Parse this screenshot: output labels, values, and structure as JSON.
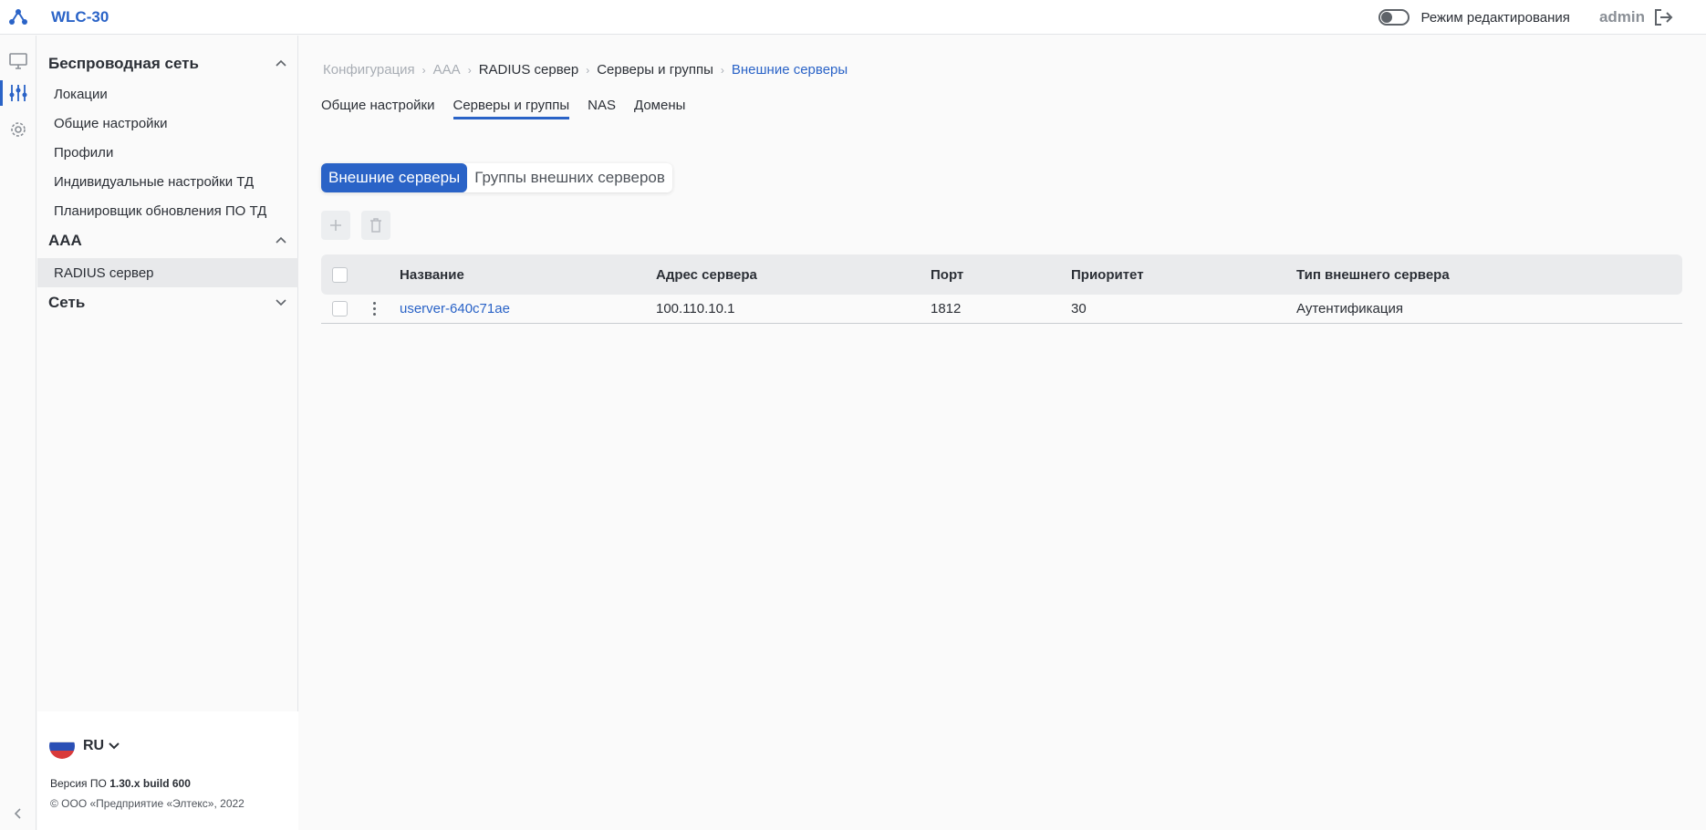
{
  "app": {
    "title": "WLC-30"
  },
  "topbar": {
    "edit_mode_label": "Режим редактирования",
    "user": "admin"
  },
  "sidebar": {
    "sections": [
      {
        "title": "Беспроводная сеть",
        "items": [
          "Локации",
          "Общие настройки",
          "Профили",
          "Индивидуальные настройки ТД",
          "Планировщик обновления ПО ТД"
        ]
      },
      {
        "title": "AAA",
        "items": [
          "RADIUS сервер"
        ]
      },
      {
        "title": "Сеть",
        "items": []
      }
    ],
    "footer": {
      "language": "RU",
      "version_prefix": "Версия ПО ",
      "version": "1.30.x build 600",
      "copyright": "© ООО «Предприятие «Элтекс», 2022"
    }
  },
  "breadcrumb": [
    "Конфигурация",
    "AAA",
    "RADIUS сервер",
    "Серверы и группы",
    "Внешние серверы"
  ],
  "tabs": [
    "Общие настройки",
    "Серверы и группы",
    "NAS",
    "Домены"
  ],
  "segments": [
    "Внешние серверы",
    "Группы внешних серверов"
  ],
  "table": {
    "columns": [
      "Название",
      "Адрес сервера",
      "Порт",
      "Приоритет",
      "Тип внешнего сервера"
    ],
    "rows": [
      {
        "name": "userver-640c71ae",
        "address": "100.110.10.1",
        "port": "1812",
        "priority": "30",
        "type": "Аутентификация"
      }
    ]
  },
  "colors": {
    "accent": "#2a63c7",
    "text": "#2b2f36",
    "muted": "#a8adb4"
  }
}
